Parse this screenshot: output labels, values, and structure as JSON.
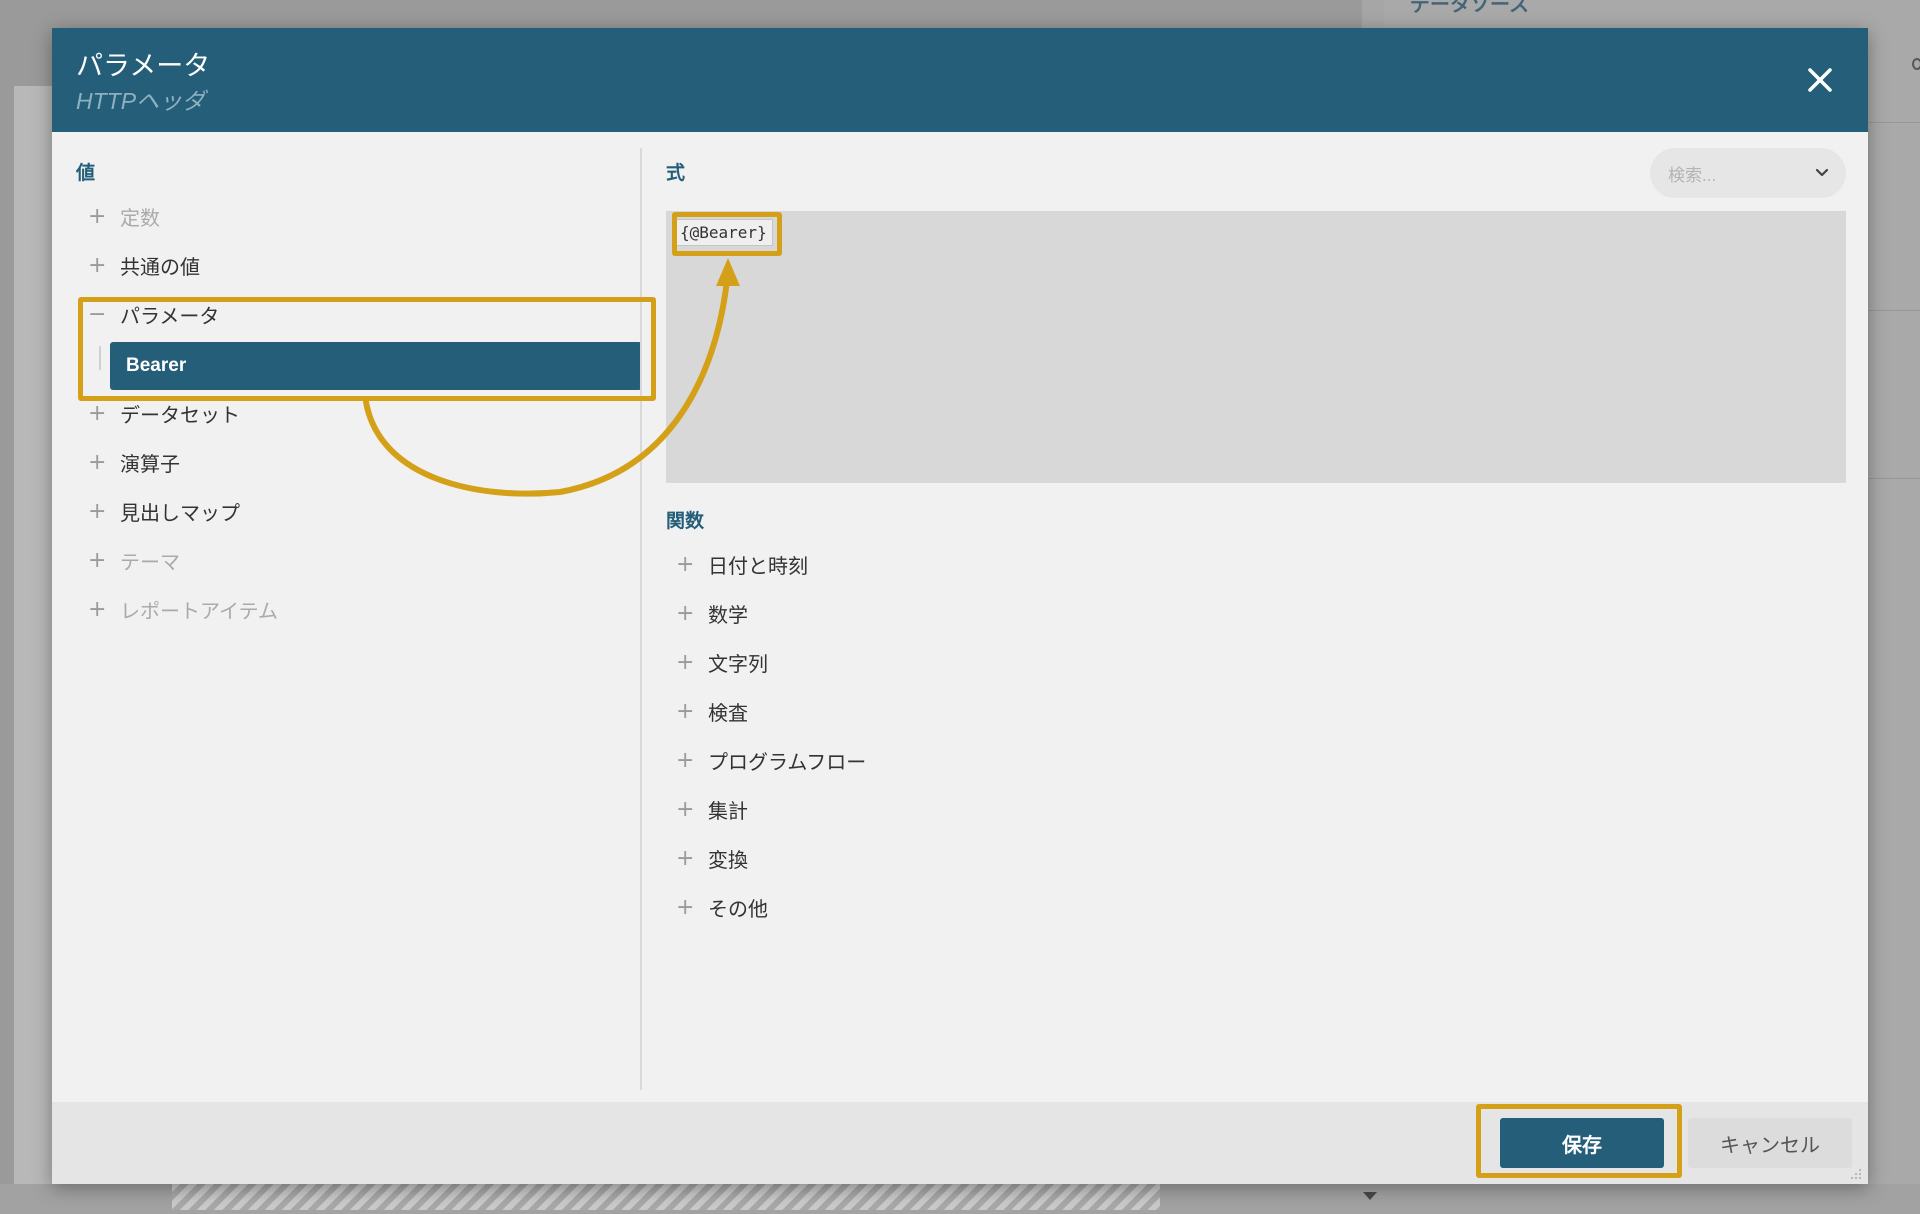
{
  "background": {
    "panel_heading": "データソース"
  },
  "dialog": {
    "title": "パラメータ",
    "subtitle": "HTTPヘッダ",
    "close_icon": "close-icon"
  },
  "values": {
    "label": "値",
    "items": [
      {
        "label": "定数",
        "expander": "+",
        "muted": true
      },
      {
        "label": "共通の値",
        "expander": "+",
        "muted": false
      },
      {
        "label": "パラメータ",
        "expander": "−",
        "muted": false
      },
      {
        "label": "データセット",
        "expander": "+",
        "muted": false
      },
      {
        "label": "演算子",
        "expander": "+",
        "muted": false
      },
      {
        "label": "見出しマップ",
        "expander": "+",
        "muted": false
      },
      {
        "label": "テーマ",
        "expander": "+",
        "muted": true
      },
      {
        "label": "レポートアイテム",
        "expander": "+",
        "muted": true
      }
    ],
    "selected_child": "Bearer"
  },
  "expression": {
    "label": "式",
    "search_placeholder": "検索...",
    "value": "{@Bearer}"
  },
  "functions": {
    "label": "関数",
    "items": [
      {
        "label": "日付と時刻"
      },
      {
        "label": "数学"
      },
      {
        "label": "文字列"
      },
      {
        "label": "検査"
      },
      {
        "label": "プログラムフロー"
      },
      {
        "label": "集計"
      },
      {
        "label": "変換"
      },
      {
        "label": "その他"
      }
    ]
  },
  "footer": {
    "save_label": "保存",
    "cancel_label": "キャンセル"
  },
  "colors": {
    "header": "#245e79",
    "accent": "#245e79",
    "highlight": "#d4a017",
    "body": "#f1f1f1"
  }
}
